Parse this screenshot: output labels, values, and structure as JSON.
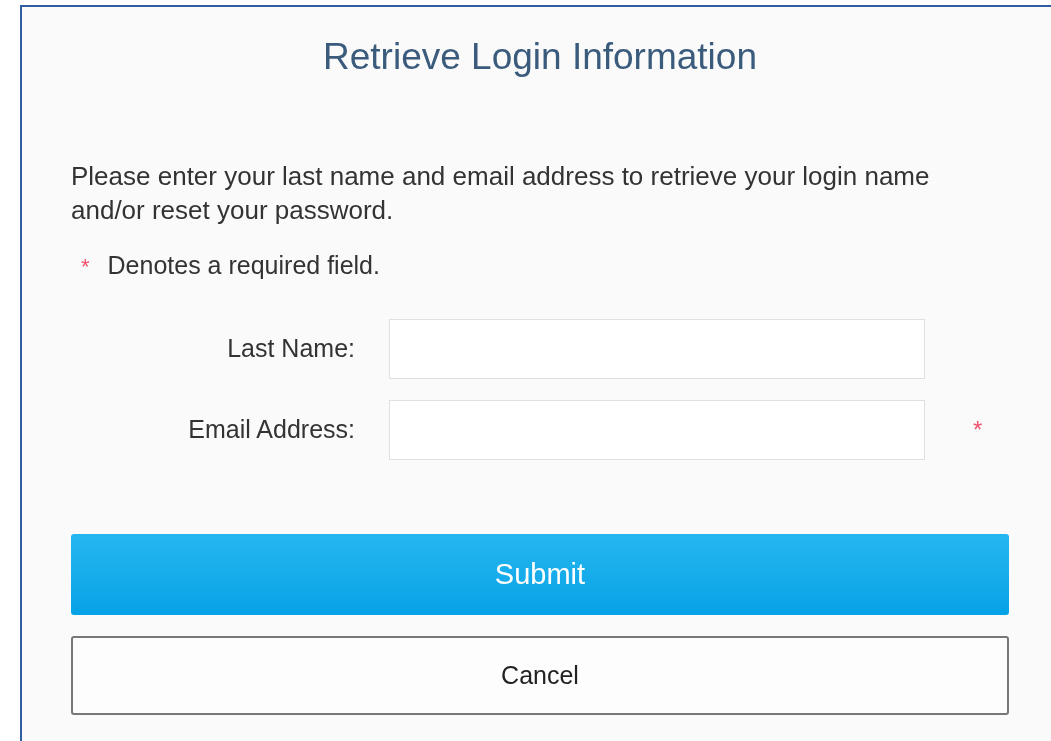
{
  "title": "Retrieve Login Information",
  "instructions": "Please enter your last name and email address to retrieve your login name and/or reset your password.",
  "required_note": {
    "marker": "*",
    "text": "Denotes a required field."
  },
  "fields": [
    {
      "label": "Last Name:",
      "required": false
    },
    {
      "label": "Email Address:",
      "required": true,
      "marker": "*"
    }
  ],
  "buttons": [
    {
      "label": "Submit",
      "kind": "primary"
    },
    {
      "label": "Cancel",
      "kind": "secondary"
    }
  ]
}
